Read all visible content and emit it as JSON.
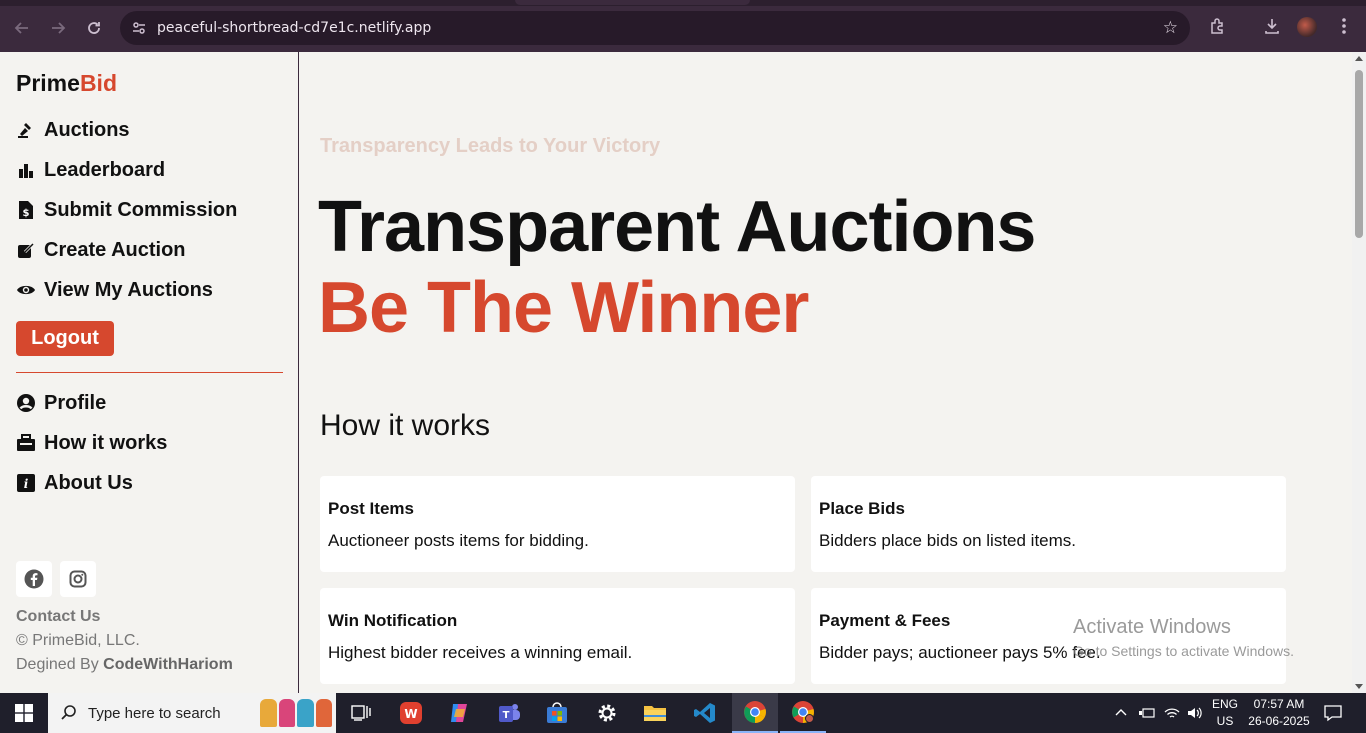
{
  "browser": {
    "url": "peaceful-shortbread-cd7e1c.netlify.app"
  },
  "sidebar": {
    "logo_main": "Prime",
    "logo_accent": "Bid",
    "nav": [
      {
        "label": "Auctions",
        "icon": "gavel-icon"
      },
      {
        "label": "Leaderboard",
        "icon": "bar-chart-icon"
      },
      {
        "label": "Submit Commission",
        "icon": "dollar-file-icon"
      },
      {
        "label": "Create Auction",
        "icon": "edit-icon"
      },
      {
        "label": "View My Auctions",
        "icon": "eye-icon"
      }
    ],
    "logout_label": "Logout",
    "secondary_nav": [
      {
        "label": "Profile",
        "icon": "user-circle-icon"
      },
      {
        "label": "How it works",
        "icon": "toolbox-icon"
      },
      {
        "label": "About Us",
        "icon": "info-icon"
      }
    ],
    "contact_label": "Contact Us",
    "copyright": "© PrimeBid, LLC.",
    "designed_prefix": "Degined By ",
    "designed_by": "CodeWithHariom"
  },
  "main": {
    "tagline": "Transparency Leads to Your Victory",
    "hero_line1": "Transparent Auctions",
    "hero_line2": "Be The Winner",
    "how_title": "How it works",
    "cards": [
      {
        "title": "Post Items",
        "desc": "Auctioneer posts items for bidding."
      },
      {
        "title": "Place Bids",
        "desc": "Bidders place bids on listed items."
      },
      {
        "title": "Win Notification",
        "desc": "Highest bidder receives a winning email."
      },
      {
        "title": "Payment & Fees",
        "desc": "Bidder pays; auctioneer pays 5% fee."
      }
    ]
  },
  "watermark": {
    "line1": "Activate Windows",
    "line2": "Go to Settings to activate Windows."
  },
  "taskbar": {
    "search_placeholder": "Type here to search",
    "lang_line1": "ENG",
    "lang_line2": "US",
    "time": "07:57 AM",
    "date": "26-06-2025"
  },
  "colors": {
    "accent": "#d6482e",
    "chrome": "#3b2a3d",
    "background": "#f4f3f0"
  }
}
